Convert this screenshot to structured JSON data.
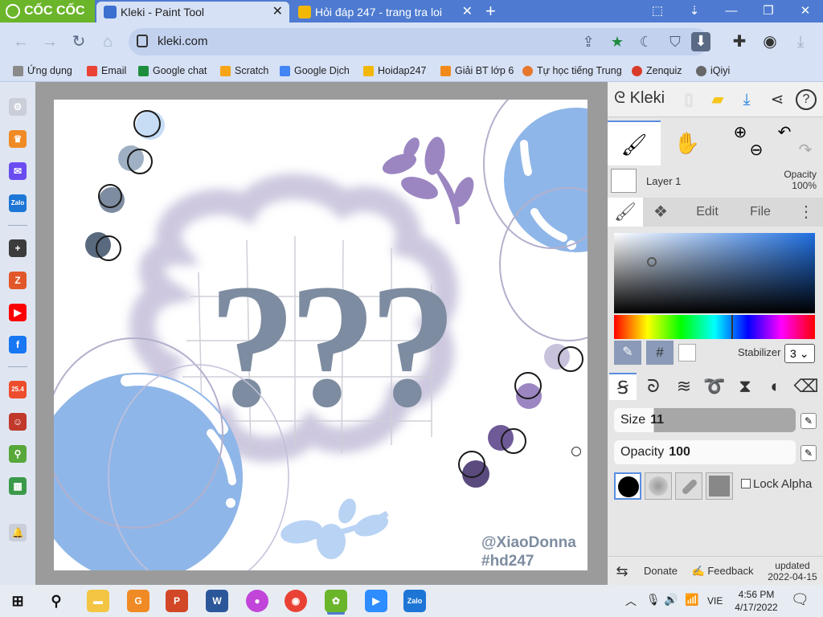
{
  "browser": {
    "brand": "CỐC CỐC",
    "tabs": [
      {
        "label": "Kleki - Paint Tool",
        "active": true
      },
      {
        "label": "Hỏi đáp 247 - trang tra loi",
        "active": false
      }
    ],
    "new_tab": "+",
    "url": "kleki.com"
  },
  "bookmarks": [
    {
      "label": "Ứng dụng",
      "color": "#8a8a8a"
    },
    {
      "label": "Email",
      "color": "#ea4335"
    },
    {
      "label": "Google chat",
      "color": "#1e8e3e"
    },
    {
      "label": "Scratch",
      "color": "#f7a417"
    },
    {
      "label": "Google Dịch",
      "color": "#4285f4"
    },
    {
      "label": "Hoidap247",
      "color": "#f2b705"
    },
    {
      "label": "Giải BT lớp 6",
      "color": "#f28a1b"
    },
    {
      "label": "Tự học tiếng Trung",
      "color": "#e8772e"
    },
    {
      "label": "Zenquiz",
      "color": "#d93b2b"
    },
    {
      "label": "iQiyi",
      "color": "#666666"
    }
  ],
  "sidebar": {
    "items": [
      {
        "name": "sidebar-settings-icon",
        "glyph": "⚙",
        "color": "#c9ced8"
      },
      {
        "name": "sidebar-crown-icon",
        "glyph": "♛",
        "color": "#f08a24"
      },
      {
        "name": "sidebar-messenger-icon",
        "glyph": "✉",
        "color": "#6a4df2"
      },
      {
        "name": "sidebar-zalo-icon",
        "glyph": "Zalo",
        "color": "#1d76d6"
      },
      {
        "name": "sidebar-add-icon",
        "glyph": "+",
        "color": "#3c3c3c"
      },
      {
        "name": "sidebar-zenquiz-icon",
        "glyph": "Z",
        "color": "#e2572a"
      },
      {
        "name": "sidebar-youtube-icon",
        "glyph": "▶",
        "color": "#ff0000"
      },
      {
        "name": "sidebar-facebook-icon",
        "glyph": "f",
        "color": "#1877f2"
      },
      {
        "name": "sidebar-shopee-icon",
        "glyph": "25.4",
        "color": "#ee4d2d"
      },
      {
        "name": "sidebar-game-icon",
        "glyph": "☺",
        "color": "#c0392b"
      },
      {
        "name": "sidebar-map-icon",
        "glyph": "⚲",
        "color": "#58a83a"
      },
      {
        "name": "sidebar-sheet-icon",
        "glyph": "▦",
        "color": "#3a9a4a"
      },
      {
        "name": "sidebar-bell-icon",
        "glyph": "🔔",
        "color": "#c9ced8"
      }
    ]
  },
  "kleki": {
    "logo": "Kleki",
    "layer_name": "Layer 1",
    "opacity_label": "Opacity",
    "opacity_value": "100%",
    "tabs": {
      "edit": "Edit",
      "file": "File"
    },
    "hash": "#",
    "stabilizer_label": "Stabilizer",
    "stabilizer_value": "3",
    "size_label": "Size",
    "size_value": "11",
    "brush_opacity_label": "Opacity",
    "brush_opacity_value": "100",
    "lock_alpha": "Lock Alpha",
    "donate": "Donate",
    "feedback": "Feedback",
    "updated_label": "updated",
    "updated_date": "2022-04-15"
  },
  "artwork": {
    "question_marks": "???",
    "credit_1": "@XiaoDonna",
    "credit_2": "#hd247",
    "colors": {
      "bubble": "#8fb6e8",
      "cloud": "#c8c2dc",
      "leaf": "#9b86c2",
      "qmark": "#7d8ca0"
    }
  },
  "taskbar": {
    "lang": "VIE",
    "time": "4:56 PM",
    "date": "4/17/2022"
  }
}
